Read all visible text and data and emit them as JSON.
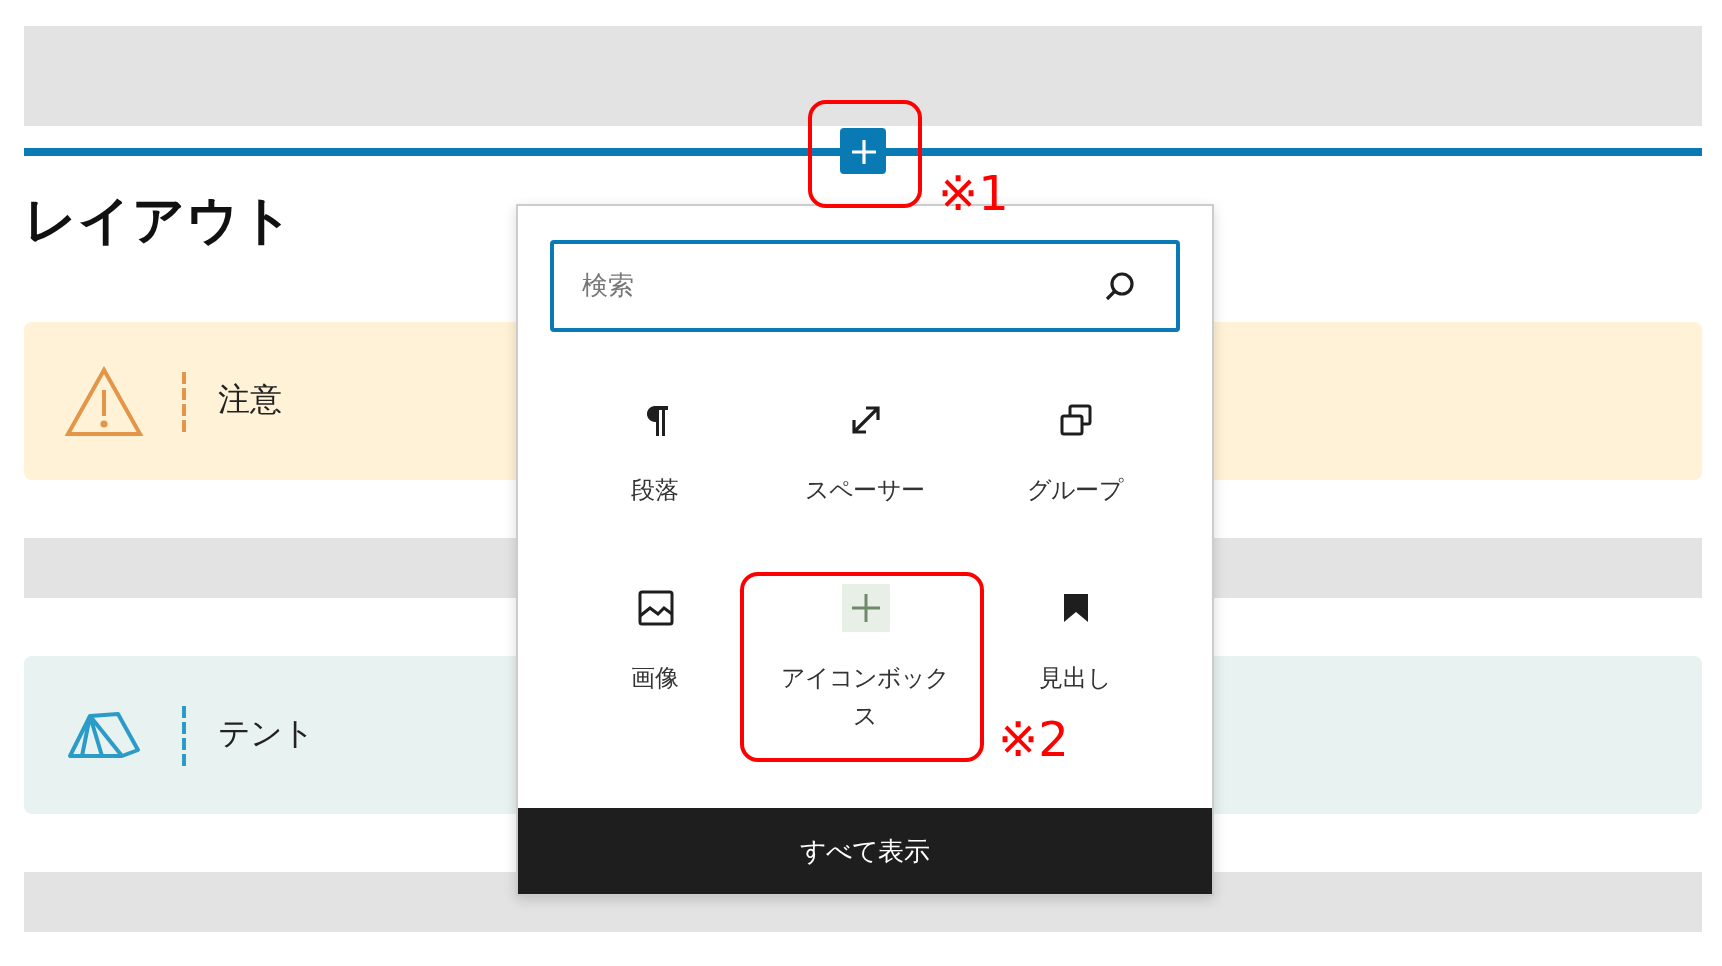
{
  "blocks": [
    {
      "kind": "empty"
    },
    {
      "kind": "inserter-line"
    },
    {
      "kind": "heading",
      "text": "レイアウト"
    },
    {
      "kind": "warning",
      "text": "注意"
    },
    {
      "kind": "empty"
    },
    {
      "kind": "tent",
      "text": "テント"
    },
    {
      "kind": "empty"
    }
  ],
  "inserter": {
    "search": {
      "placeholder": "検索"
    },
    "items": [
      {
        "kind": "paragraph",
        "label": "段落"
      },
      {
        "kind": "spacer",
        "label": "スペーサー"
      },
      {
        "kind": "group",
        "label": "グループ"
      },
      {
        "kind": "image",
        "label": "画像"
      },
      {
        "kind": "iconbox",
        "label": "アイコンボックス"
      },
      {
        "kind": "heading",
        "label": "見出し"
      }
    ],
    "footer_button": "すべて表示"
  },
  "annotations": [
    {
      "label": "※1"
    },
    {
      "label": "※2"
    }
  ]
}
